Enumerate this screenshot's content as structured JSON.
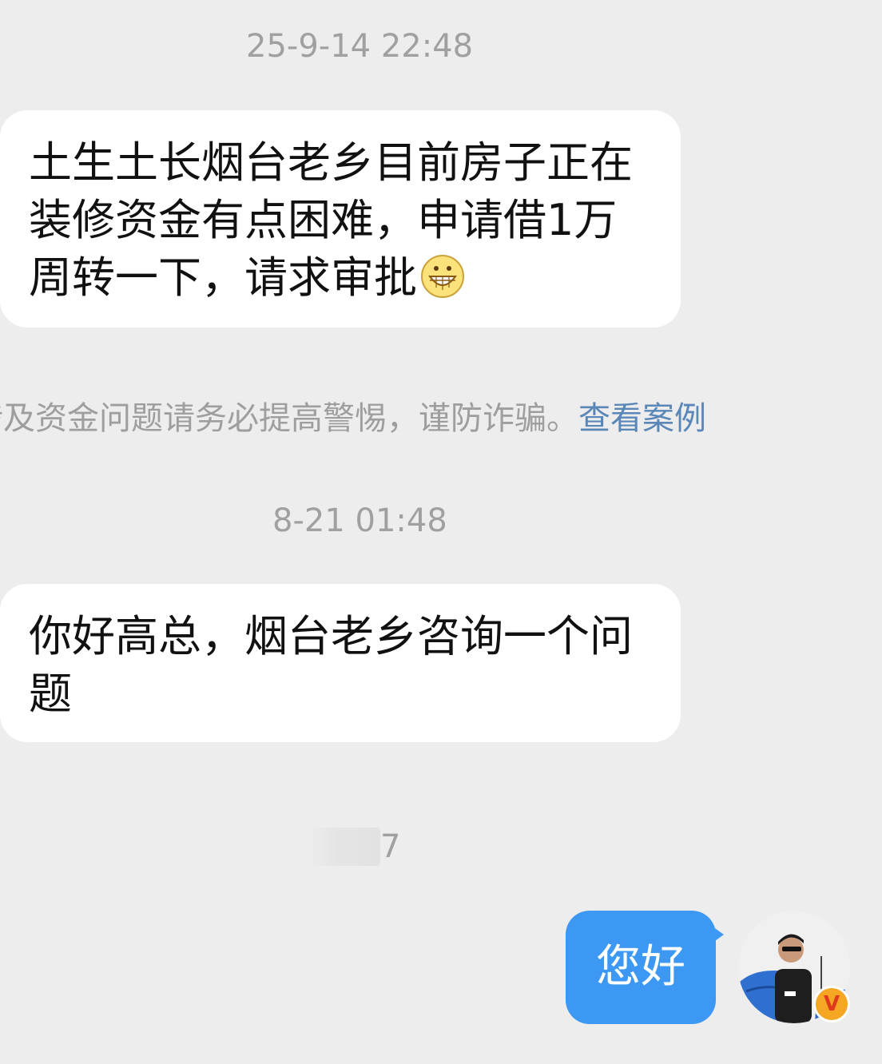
{
  "timestamps": {
    "first": "25-9-14 22:48",
    "second": "8-21 01:48"
  },
  "messages": {
    "incoming_1": {
      "text": "土生土长烟台老乡目前房子正在\n装修资金有点困难，申请借1万\n周转一下，请求审批",
      "emoji": "grinning-face-emoji"
    },
    "incoming_2": {
      "text": "你好高总，烟台老乡咨询一个问\n题"
    },
    "outgoing_1": {
      "text": "您好"
    }
  },
  "warning": {
    "text": "涉及资金问题请务必提高警惕，谨防诈骗。",
    "link": "查看案例"
  },
  "blurred_timestamp": {
    "visible_text": "7"
  },
  "colors": {
    "background": "#ededed",
    "incoming_bubble": "#ffffff",
    "outgoing_bubble": "#3d98f3",
    "link": "#5a86b8",
    "muted_text": "#a0a0a0"
  },
  "avatar": {
    "badge": "V"
  }
}
